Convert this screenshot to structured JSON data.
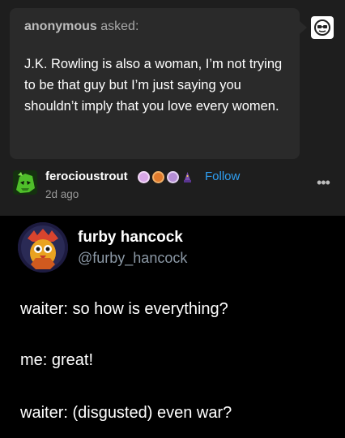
{
  "ask": {
    "asker": "anonymous",
    "asked_label": "asked:",
    "question": "J.K. Rowling is also a woman, I’m not trying to be that guy but I’m just saying you shouldn’t imply that you love every women."
  },
  "reblog": {
    "username": "ferocioustrout",
    "follow_label": "Follow",
    "time": "2d ago",
    "more_icon": "more-icon",
    "badge_colors": [
      "#d9a7e8",
      "#e07a2c",
      "#b58dd6",
      "#7a4fb0"
    ]
  },
  "tweet": {
    "display_name": "furby hancock",
    "handle": "@furby_hancock",
    "lines": [
      "waiter: so how is everything?",
      "me: great!",
      "waiter: (disgusted) even war?"
    ]
  },
  "colors": {
    "accent": "#2f9ff2",
    "background": "#1e1e1e",
    "tweet_background": "#000000"
  }
}
